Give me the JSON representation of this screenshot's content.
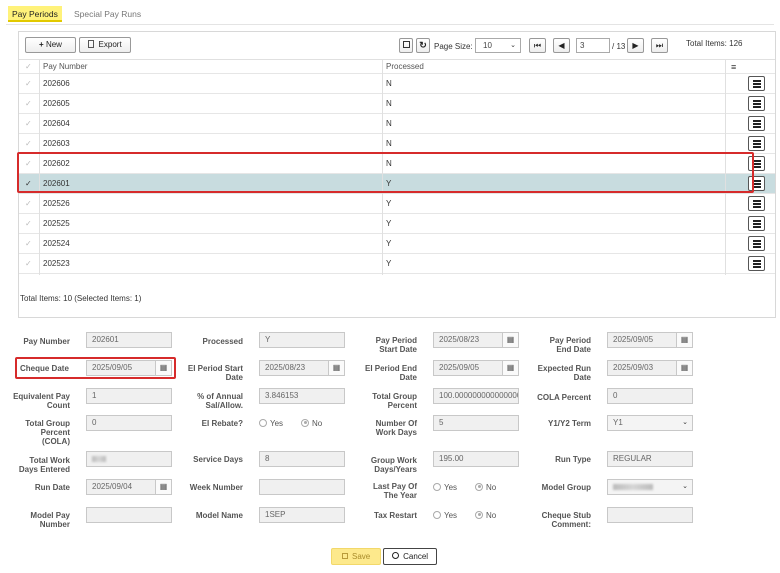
{
  "tabs": {
    "pay_periods": "Pay Periods",
    "special_pay_runs": "Special Pay Runs"
  },
  "toolbar": {
    "new_label": "New",
    "export_label": "Export",
    "page_size_label": "Page Size:",
    "page_size_value": "10",
    "page_input": "3",
    "page_total": "/ 13",
    "total_items": "Total Items: 126"
  },
  "grid": {
    "col_pay_number": "Pay Number",
    "col_processed": "Processed",
    "rows": [
      {
        "pay_number": "202606",
        "processed": "N"
      },
      {
        "pay_number": "202605",
        "processed": "N"
      },
      {
        "pay_number": "202604",
        "processed": "N"
      },
      {
        "pay_number": "202603",
        "processed": "N"
      },
      {
        "pay_number": "202602",
        "processed": "N"
      },
      {
        "pay_number": "202601",
        "processed": "Y"
      },
      {
        "pay_number": "202526",
        "processed": "Y"
      },
      {
        "pay_number": "202525",
        "processed": "Y"
      },
      {
        "pay_number": "202524",
        "processed": "Y"
      },
      {
        "pay_number": "202523",
        "processed": "Y"
      }
    ],
    "footer": "Total Items: 10 (Selected Items: 1)"
  },
  "form": {
    "pay_number": {
      "label": "Pay Number",
      "value": "202601"
    },
    "processed": {
      "label": "Processed",
      "value": "Y"
    },
    "pay_period_start": {
      "label_1": "Pay Period",
      "label_2": "Start Date",
      "value": "2025/08/23"
    },
    "pay_period_end": {
      "label_1": "Pay Period",
      "label_2": "End Date",
      "value": "2025/09/05"
    },
    "cheque_date": {
      "label": "Cheque Date",
      "value": "2025/09/05"
    },
    "ei_period_start": {
      "label_1": "EI Period Start",
      "label_2": "Date",
      "value": "2025/08/23"
    },
    "ei_period_end": {
      "label_1": "EI Period End",
      "label_2": "Date",
      "value": "2025/09/05"
    },
    "expected_run": {
      "label_1": "Expected Run",
      "label_2": "Date",
      "value": "2025/09/03"
    },
    "equivalent_pay_count": {
      "label_1": "Equivalent Pay",
      "label_2": "Count",
      "value": "1"
    },
    "pct_annual": {
      "label_1": "% of Annual",
      "label_2": "Sal/Allow.",
      "value": "3.846153"
    },
    "total_group_percent": {
      "label_1": "Total Group",
      "label_2": "Percent",
      "value": "100.000000000000000"
    },
    "cola_percent": {
      "label": "COLA Percent",
      "value": "0"
    },
    "total_group_percent_cola": {
      "label_1": "Total Group",
      "label_2": "Percent",
      "label_3": "(COLA)",
      "value": "0"
    },
    "ei_rebate": {
      "label": "EI Rebate?",
      "yes": "Yes",
      "no": "No"
    },
    "number_of_work_days": {
      "label_1": "Number Of",
      "label_2": "Work Days",
      "value": "5"
    },
    "y1y2_term": {
      "label": "Y1/Y2 Term",
      "value": "Y1"
    },
    "total_work_days_entered": {
      "label_1": "Total Work",
      "label_2": "Days Entered"
    },
    "service_days": {
      "label": "Service Days",
      "value": "8"
    },
    "group_work_days": {
      "label_1": "Group Work",
      "label_2": "Days/Years",
      "value": "195.00"
    },
    "run_type": {
      "label": "Run Type",
      "value": "REGULAR"
    },
    "run_date": {
      "label": "Run Date",
      "value": "2025/09/04"
    },
    "week_number": {
      "label": "Week Number",
      "value": ""
    },
    "last_pay_of_year": {
      "label_1": "Last Pay Of",
      "label_2": "The Year",
      "yes": "Yes",
      "no": "No"
    },
    "model_group": {
      "label": "Model Group"
    },
    "model_pay_number": {
      "label_1": "Model Pay",
      "label_2": "Number",
      "value": ""
    },
    "model_name": {
      "label": "Model Name",
      "value": "1SEP"
    },
    "tax_restart": {
      "label": "Tax Restart",
      "yes": "Yes",
      "no": "No"
    },
    "cheque_stub_comment": {
      "label_1": "Cheque Stub",
      "label_2": "Comment:",
      "value": ""
    }
  },
  "actions": {
    "save_label": "Save",
    "cancel_label": "Cancel"
  },
  "colors": {
    "accent_yellow": "#fff27a",
    "selected_row": "#c8dcdf",
    "highlight_red": "#d62b2b"
  }
}
